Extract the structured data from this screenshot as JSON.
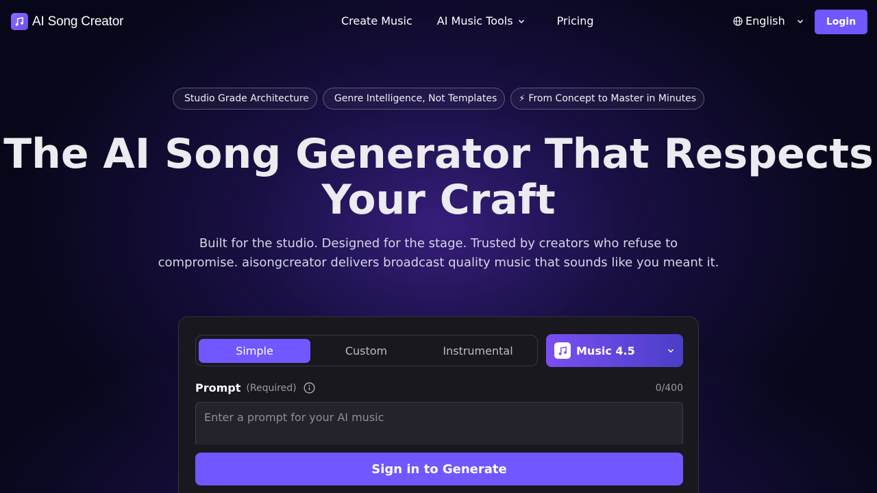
{
  "brand": {
    "name": "AI Song Creator",
    "logo_icon": "music-note-icon"
  },
  "nav": {
    "links": [
      "Create Music",
      "AI Music Tools",
      "Pricing"
    ],
    "language": "English",
    "login_label": "Login"
  },
  "badges": [
    {
      "icon": "",
      "text": "Studio Grade Architecture"
    },
    {
      "icon": "",
      "text": "Genre Intelligence, Not Templates"
    },
    {
      "icon": "⚡",
      "text": "From Concept to Master in Minutes"
    }
  ],
  "hero": {
    "title_line1": "The AI Song Generator That Respects",
    "title_line2": "Your Craft",
    "subtitle_line1": "Built for the studio. Designed for the stage. Trusted by creators who refuse to",
    "subtitle_line2": "compromise. aisongcreator delivers broadcast quality music that sounds like you meant it."
  },
  "generator": {
    "tabs": [
      "Simple",
      "Custom",
      "Instrumental"
    ],
    "active_tab": "Simple",
    "model": "Music 4.5",
    "prompt_label": "Prompt",
    "prompt_required": "(Required)",
    "prompt_count": "0/400",
    "prompt_placeholder": "Enter a prompt for your AI music",
    "prompt_value": "",
    "generate_label": "Sign in to Generate"
  },
  "colors": {
    "accent": "#7057ff",
    "background": "#07071a",
    "card": "#19181f"
  }
}
